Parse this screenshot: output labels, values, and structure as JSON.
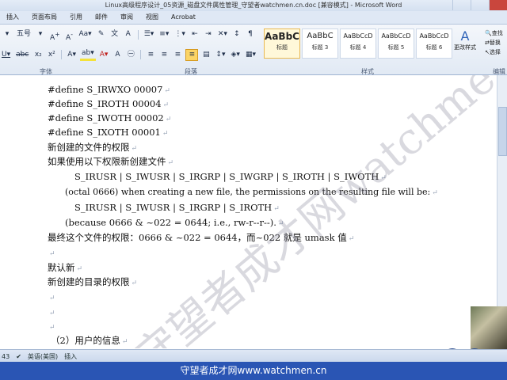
{
  "window": {
    "title": "Linux高级程序设计_05资源_磁盘文件属性管理_守望者watchmen.cn.doc [兼容模式] - Microsoft Word"
  },
  "tabs": [
    "插入",
    "页面布局",
    "引用",
    "邮件",
    "审阅",
    "视图",
    "Acrobat"
  ],
  "ribbon": {
    "font_size": "五号",
    "groups": {
      "font": "字体",
      "paragraph": "段落",
      "styles": "样式",
      "editing": "编辑"
    },
    "styles": [
      {
        "preview": "AaBbC",
        "name": "标题"
      },
      {
        "preview": "AaBbC",
        "name": "标题 3"
      },
      {
        "preview": "AaBbCcD",
        "name": "标题 4"
      },
      {
        "preview": "AaBbCcD",
        "name": "标题 5"
      },
      {
        "preview": "AaBbCcD",
        "name": "标题 6"
      }
    ],
    "change_styles": "更改样式",
    "edit_labels": [
      "查找",
      "替换",
      "选择"
    ]
  },
  "document": {
    "lines": [
      "#define S_IRWXO 00007",
      "#define S_IROTH 00004",
      "#define S_IWOTH 00002",
      "#define S_IXOTH 00001",
      "新创建的文件的权限",
      "如果使用以下权限新创建文件",
      "S_IRUSR | S_IWUSR | S_IRGRP | S_IWGRP | S_IROTH | S_IWOTH",
      "(octal 0666) when creating a new file, the permissions on the resulting file will be:",
      "S_IRUSR | S_IWUSR | S_IRGRP | S_IROTH",
      "(because 0666 & ~022 = 0644; i.e., rw-r--r--).",
      "最终这个文件的权限：0666 & ~022 = 0644，而~022 就是 umask 值",
      "",
      "默认新",
      "新创建的目录的权限",
      "",
      "",
      "",
      "（2）用户的信息"
    ],
    "watermark": "守望者成才网watchmen.cn"
  },
  "status": {
    "page_info": "43",
    "language": "英语(美国)",
    "mode": "插入"
  },
  "footer": {
    "text": "守望者成才网www.watchmen.cn"
  },
  "colors": {
    "ribbon": "#e1e9f4",
    "footer": "#2a55b4",
    "highlight": "#fbd465"
  }
}
